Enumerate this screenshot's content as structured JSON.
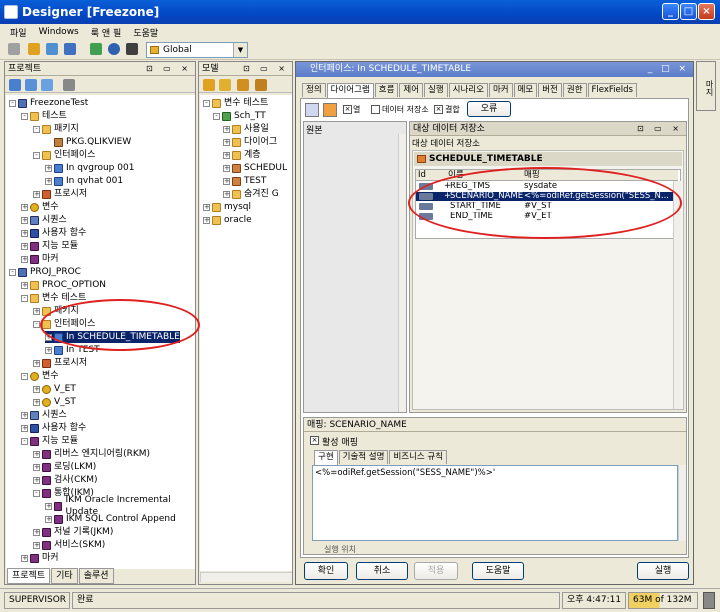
{
  "window": {
    "title": "Designer [Freezone]"
  },
  "menu": [
    "파일",
    "Windows",
    "룩 앤 필",
    "도움말"
  ],
  "toolbar": {
    "context": "Global"
  },
  "projects_panel": {
    "title": "프로젝트",
    "tree": [
      {
        "label": "FreezoneTest",
        "icon": "project",
        "depth": 0,
        "exp": "-"
      },
      {
        "label": "테스트",
        "icon": "folder",
        "depth": 1,
        "exp": "-"
      },
      {
        "label": "패키지",
        "icon": "folder",
        "depth": 2,
        "exp": "-"
      },
      {
        "label": "PKG.QLIKVIEW",
        "icon": "package",
        "depth": 3,
        "exp": ""
      },
      {
        "label": "인터페이스",
        "icon": "folder",
        "depth": 2,
        "exp": "-"
      },
      {
        "label": "In qvgroup 001",
        "icon": "interface",
        "depth": 3,
        "exp": "+"
      },
      {
        "label": "In qvhat 001",
        "icon": "interface",
        "depth": 3,
        "exp": "+"
      },
      {
        "label": "프로시저",
        "icon": "procedure",
        "depth": 2,
        "exp": "+"
      },
      {
        "label": "변수",
        "icon": "variable",
        "depth": 1,
        "exp": "+"
      },
      {
        "label": "시퀀스",
        "icon": "sequence",
        "depth": 1,
        "exp": "+"
      },
      {
        "label": "사용자 함수",
        "icon": "function",
        "depth": 1,
        "exp": "+"
      },
      {
        "label": "지능 모듈",
        "icon": "km",
        "depth": 1,
        "exp": "+"
      },
      {
        "label": "마커",
        "icon": "marker",
        "depth": 1,
        "exp": "+"
      },
      {
        "label": "PROJ_PROC",
        "icon": "project",
        "depth": 0,
        "exp": "-"
      },
      {
        "label": "PROC_OPTION",
        "icon": "folder",
        "depth": 1,
        "exp": "+"
      },
      {
        "label": "변수 테스트",
        "icon": "folder",
        "depth": 1,
        "exp": "-"
      },
      {
        "label": "패키지",
        "icon": "folder",
        "depth": 2,
        "exp": "+"
      },
      {
        "label": "인터페이스",
        "icon": "folder",
        "depth": 2,
        "exp": "-"
      },
      {
        "label": "In SCHEDULE_TIMETABLE",
        "icon": "interface",
        "depth": 3,
        "exp": "+",
        "selected": true
      },
      {
        "label": "In TEST",
        "icon": "interface",
        "depth": 3,
        "exp": "+"
      },
      {
        "label": "프로시저",
        "icon": "procedure",
        "depth": 2,
        "exp": "+"
      },
      {
        "label": "변수",
        "icon": "variable",
        "depth": 1,
        "exp": "-"
      },
      {
        "label": "V_ET",
        "icon": "variable",
        "depth": 2,
        "exp": "+"
      },
      {
        "label": "V_ST",
        "icon": "variable",
        "depth": 2,
        "exp": "+"
      },
      {
        "label": "시퀀스",
        "icon": "sequence",
        "depth": 1,
        "exp": "+"
      },
      {
        "label": "사용자 함수",
        "icon": "function",
        "depth": 1,
        "exp": "+"
      },
      {
        "label": "지능 모듈",
        "icon": "km",
        "depth": 1,
        "exp": "-"
      },
      {
        "label": "리버스 엔지니어링(RKM)",
        "icon": "km",
        "depth": 2,
        "exp": "+"
      },
      {
        "label": "로딩(LKM)",
        "icon": "km",
        "depth": 2,
        "exp": "+"
      },
      {
        "label": "검사(CKM)",
        "icon": "km",
        "depth": 2,
        "exp": "+"
      },
      {
        "label": "통합(IKM)",
        "icon": "km",
        "depth": 2,
        "exp": "-"
      },
      {
        "label": "IKM Oracle Incremental Update",
        "icon": "km",
        "depth": 3,
        "exp": "+"
      },
      {
        "label": "IKM SQL Control Append",
        "icon": "km",
        "depth": 3,
        "exp": "+"
      },
      {
        "label": "저널 기록(JKM)",
        "icon": "km",
        "depth": 2,
        "exp": "+"
      },
      {
        "label": "서비스(SKM)",
        "icon": "km",
        "depth": 2,
        "exp": "+"
      },
      {
        "label": "마커",
        "icon": "marker",
        "depth": 1,
        "exp": "+"
      }
    ],
    "bottom_tabs": [
      "프로젝트",
      "기타",
      "솔루션"
    ]
  },
  "models_panel": {
    "title": "모델",
    "tree": [
      {
        "label": "변수 테스트",
        "icon": "folder",
        "depth": 0,
        "exp": "-"
      },
      {
        "label": "Sch_TT",
        "icon": "model",
        "depth": 1,
        "exp": "-"
      },
      {
        "label": "사용일",
        "icon": "folder",
        "depth": 2,
        "exp": "+"
      },
      {
        "label": "다이어그",
        "icon": "folder",
        "depth": 2,
        "exp": "+"
      },
      {
        "label": "계층",
        "icon": "folder",
        "depth": 2,
        "exp": "+"
      },
      {
        "label": "SCHEDUL",
        "icon": "table",
        "depth": 2,
        "exp": "+"
      },
      {
        "label": "TEST",
        "icon": "table",
        "depth": 2,
        "exp": "+"
      },
      {
        "label": "숨겨진 G",
        "icon": "folder",
        "depth": 2,
        "exp": "+"
      },
      {
        "label": "mysql",
        "icon": "folder",
        "depth": 0,
        "exp": "+"
      },
      {
        "label": "oracle",
        "icon": "folder",
        "depth": 0,
        "exp": "+"
      }
    ]
  },
  "editor": {
    "title": "인터페이스: In SCHEDULE_TIMETABLE",
    "tabs": [
      "정의",
      "다이어그램",
      "흐름",
      "제어",
      "실행",
      "시나리오",
      "마커",
      "메모",
      "버전",
      "권한",
      "FlexFields"
    ],
    "active_tab": "다이어그램",
    "source_label": "원본",
    "toolbar": {
      "dataset_label": "데이터 저장소",
      "join_label": "결합",
      "error_label": "오류",
      "checkbox_a": "열"
    },
    "target": {
      "title": "대상 데이터 저장소",
      "subtitle": "대상 데이터 저장소",
      "table_name": "SCHEDULE_TIMETABLE",
      "columns": [
        "Id",
        "이름",
        "매핑"
      ],
      "rows": [
        {
          "name": "REG_TMS",
          "mapping": "sysdate",
          "flag": "+"
        },
        {
          "name": "SCENARIO_NAME",
          "mapping": "<%=odiRef.getSession(\"SESS_N...",
          "flag": "+",
          "selected": true
        },
        {
          "name": "START_TIME",
          "mapping": "#V_ST",
          "flag": ""
        },
        {
          "name": "END_TIME",
          "mapping": "#V_ET",
          "flag": ""
        }
      ]
    },
    "mapping_panel": {
      "title": "매핑: SCENARIO_NAME",
      "active_label": "활성 매핑",
      "tabs": [
        "구현",
        "기술적 설명",
        "비즈니스 규칙"
      ],
      "expression": "<%=odiRef.getSession(\"SESS_NAME\")%>'",
      "exec_label": "실행 위치"
    },
    "buttons": {
      "ok": "확인",
      "cancel": "취소",
      "apply": "적용",
      "help": "도움말",
      "execute": "실행"
    }
  },
  "right_sidebar": {
    "label": "마지"
  },
  "status": {
    "user": "SUPERVISOR",
    "state": "완료",
    "time": "오후 4:47:11",
    "memory": "63M of 132M"
  },
  "colors": {
    "title_blue": "#0a4fd0",
    "selection": "#0a246a",
    "annotation_red": "#e02020"
  }
}
